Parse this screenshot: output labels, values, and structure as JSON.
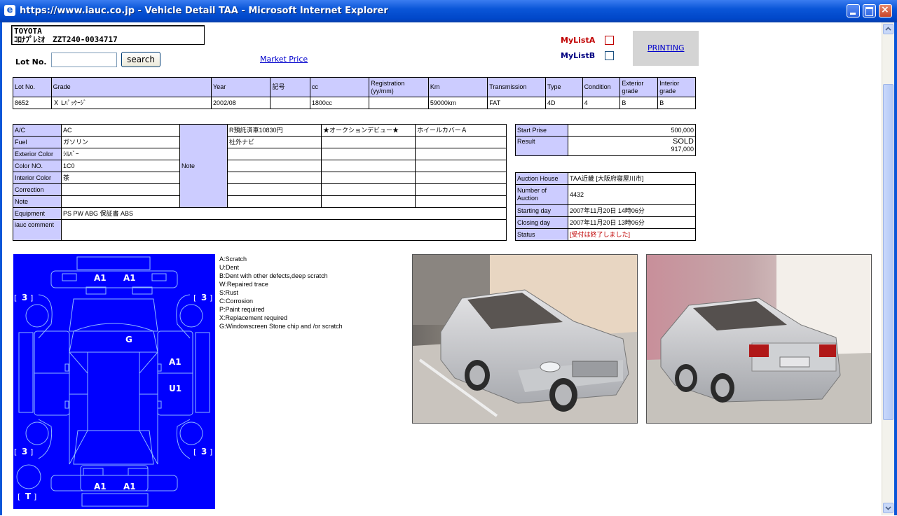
{
  "window": {
    "title": "https://www.iauc.co.jp - Vehicle Detail TAA - Microsoft Internet Explorer"
  },
  "vehicle": {
    "make": "TOYOTA",
    "model_line": "ｺﾛﾅﾌﾟﾚﾐｵ　ZZT240-0034717"
  },
  "lot_search": {
    "label": "Lot No.",
    "value": "",
    "button": "search"
  },
  "market_price_link": "Market Price",
  "mylist": {
    "a_label": "MyListA",
    "b_label": "MyListB",
    "a_checked": false,
    "b_checked": false
  },
  "printing_label": "PRINTING",
  "summary_table": {
    "headers": [
      "Lot No.",
      "Grade",
      "Year",
      "記号",
      "cc",
      "Registration (yy/mm)",
      "Km",
      "Transmission",
      "Type",
      "Condition",
      "Exterior grade",
      "Interior grade"
    ],
    "row": [
      "8652",
      "Ｘ Lﾊﾟｯｹｰｼﾞ",
      "2002/08",
      "",
      "1800cc",
      "",
      "59000km",
      "FAT",
      "4D",
      "4",
      "B",
      "B"
    ]
  },
  "specs": {
    "labels": [
      "A/C",
      "Fuel",
      "Exterior Color",
      "Color NO.",
      "Interior Color",
      "Correction",
      "Note",
      "Equipment",
      "iauc comment"
    ],
    "values": [
      "AC",
      "ガソリン",
      "ｼﾙﾊﾞｰ",
      "1C0",
      "茶",
      "",
      "",
      "PS PW ABG 保証書 ABS",
      ""
    ],
    "note_label": "Note",
    "note_grid": [
      [
        "R預託済車10830円",
        "★オークションデビュー★",
        "ホイールカバーＡ"
      ],
      [
        "社外ナビ",
        "",
        ""
      ]
    ]
  },
  "price": {
    "start_label": "Start Prise",
    "start_value": "500,000",
    "result_label": "Result",
    "result_status": "SOLD",
    "result_value": "917,000"
  },
  "auction": {
    "house_label": "Auction House",
    "house_value": "TAA近畿 [大阪府寝屋川市]",
    "number_label": "Number of Auction",
    "number_value": "4432",
    "starting_label": "Starting day",
    "starting_value": "2007年11月20日 14時06分",
    "closing_label": "Closing day",
    "closing_value": "2007年11月20日 13時06分",
    "status_label": "Status",
    "status_value": "[受付は終了しました]"
  },
  "damage_marks": {
    "front_left": "A1",
    "front_right": "A1",
    "hood": "G",
    "door_front": "A1",
    "door_rear": "U1",
    "rear_left": "A1",
    "rear_right": "A1",
    "wheel_fl": "3",
    "wheel_fr": "3",
    "wheel_rl": "3",
    "wheel_rr": "3",
    "spare": "T"
  },
  "legend": [
    "A:Scratch",
    "U:Dent",
    "B:Dent with other defects,deep scratch",
    "W:Repaired trace",
    "S:Rust",
    "C:Corrosion",
    "P:Paint required",
    "X:Replacement required",
    "G:Windowscreen Stone chip and /or scratch"
  ],
  "colors": {
    "header_cell": "#ccccff",
    "diagram_bg": "#0000ff",
    "status_red": "#c00000",
    "titlebar": "#0a56d8"
  }
}
